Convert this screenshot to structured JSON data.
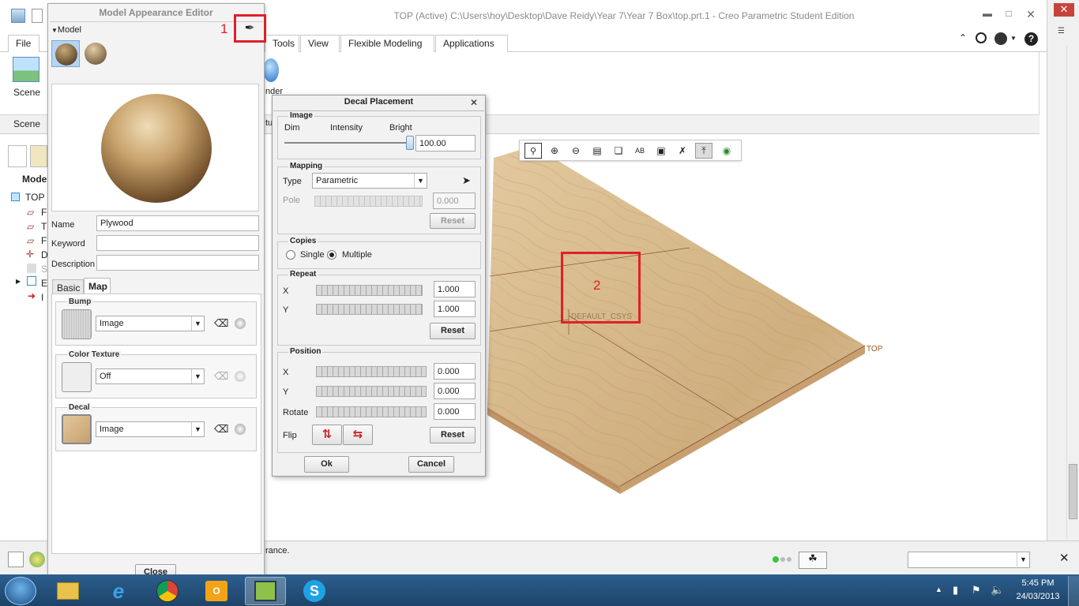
{
  "window": {
    "title": "TOP (Active) C:\\Users\\hoy\\Desktop\\Dave Reidy\\Year 7\\Year 7 Box\\top.prt.1 - Creo Parametric Student Edition"
  },
  "ribbon": {
    "file_label": "File",
    "tabs": [
      "Tools",
      "View",
      "Flexible Modeling",
      "Applications"
    ],
    "scene_button": "Scene",
    "scene_group": "Scene",
    "render_label_partial": "nder",
    "tu_label": "tu",
    "model_label": "Model"
  },
  "model_tree": {
    "root": "TOP",
    "items": [
      "F",
      "T",
      "F",
      "D",
      "S",
      "E",
      "I"
    ]
  },
  "appearance_editor": {
    "title": "Model Appearance Editor",
    "section_model": "Model",
    "name_label": "Name",
    "name_value": "Plywood",
    "keyword_label": "Keyword",
    "keyword_value": "",
    "description_label": "Description",
    "description_value": "",
    "tab_basic": "Basic",
    "tab_map": "Map",
    "bump": {
      "title": "Bump",
      "value": "Image"
    },
    "color_texture": {
      "title": "Color Texture",
      "value": "Off"
    },
    "decal": {
      "title": "Decal",
      "value": "Image"
    },
    "close_label": "Close"
  },
  "decal_dialog": {
    "title": "Decal Placement",
    "image": {
      "title": "Image",
      "dim": "Dim",
      "intensity": "Intensity",
      "bright": "Bright",
      "value": "100.00",
      "slider_level": 1.0
    },
    "mapping": {
      "title": "Mapping",
      "type_label": "Type",
      "type_value": "Parametric",
      "pole_label": "Pole",
      "pole_value": "0.000",
      "reset": "Reset"
    },
    "copies": {
      "title": "Copies",
      "single": "Single",
      "multiple": "Multiple",
      "selected": "Multiple"
    },
    "repeat": {
      "title": "Repeat",
      "x_label": "X",
      "x_value": "1.000",
      "y_label": "Y",
      "y_value": "1.000",
      "reset": "Reset"
    },
    "position": {
      "title": "Position",
      "x_label": "X",
      "x_value": "0.000",
      "y_label": "Y",
      "y_value": "0.000",
      "rotate_label": "Rotate",
      "rotate_value": "0.000",
      "flip_label": "Flip",
      "reset": "Reset"
    },
    "ok": "Ok",
    "cancel": "Cancel"
  },
  "annotations": {
    "one": "1",
    "two": "2"
  },
  "graphics": {
    "csys_label": "DEFAULT_CSYS",
    "top_label": "TOP"
  },
  "status": {
    "message": "rance."
  },
  "taskbar": {
    "time": "5:45 PM",
    "date": "24/03/2013"
  },
  "colors": {
    "highlight": "#e0202a",
    "wood_light": "#dcc199",
    "wood_dark": "#c4a070",
    "taskbar": "#2a5882"
  }
}
